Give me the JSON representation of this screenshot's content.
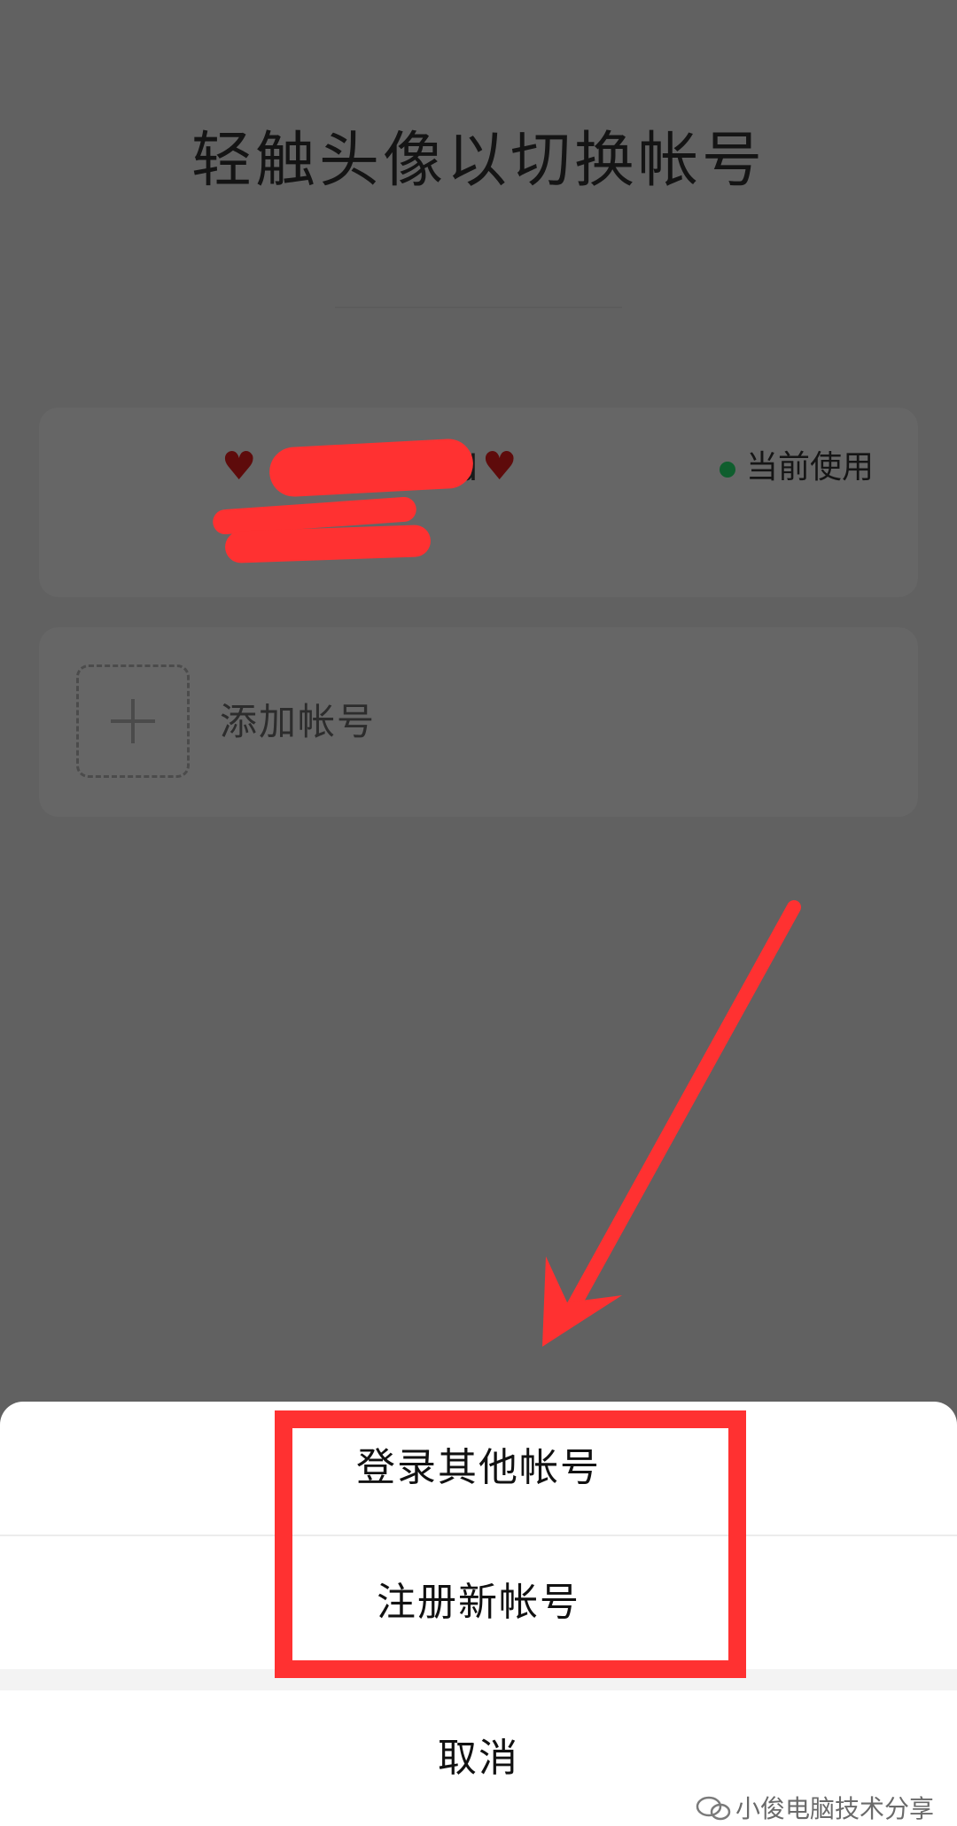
{
  "screen": {
    "title": "轻触头像以切换帐号"
  },
  "account": {
    "name_suffix": "d",
    "heart_left": "♥",
    "heart_right": "♥",
    "status_text": "当前使用",
    "status_color": "#0f5e2e"
  },
  "add_account": {
    "label": "添加帐号",
    "icon": "plus-icon"
  },
  "sheet": {
    "login_other": "登录其他帐号",
    "register_new": "注册新帐号",
    "cancel": "取消"
  },
  "annotation": {
    "color": "#ff3131"
  },
  "watermark": {
    "text": "小俊电脑技术分享",
    "icon": "wechat-icon"
  }
}
